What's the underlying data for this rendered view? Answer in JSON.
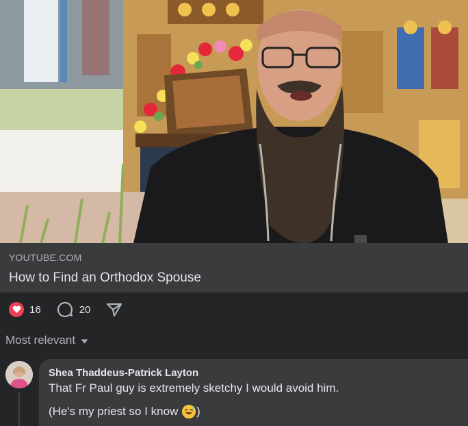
{
  "link_preview": {
    "domain": "YOUTUBE.COM",
    "title": "How to Find an Orthodox Spouse"
  },
  "reactions": {
    "likes": "16",
    "comments": "20"
  },
  "sort": {
    "label": "Most relevant"
  },
  "comment": {
    "author": "Shea Thaddeus-Patrick Layton",
    "line1": "That Fr Paul guy is extremely sketchy I would avoid him.",
    "line2_before": "(He's my priest so I know",
    "line2_after": ")"
  },
  "icons": {
    "like": "heart-icon",
    "comment": "comment-icon",
    "share": "share-icon",
    "sort": "caret-down-icon",
    "emoji": "grinning-sweat-emoji-icon"
  },
  "colors": {
    "background": "#242526",
    "surface": "#3a3b3c",
    "heart": "#f33e58",
    "text": "#e4e6eb",
    "secondary_text": "#b0b3b8"
  }
}
